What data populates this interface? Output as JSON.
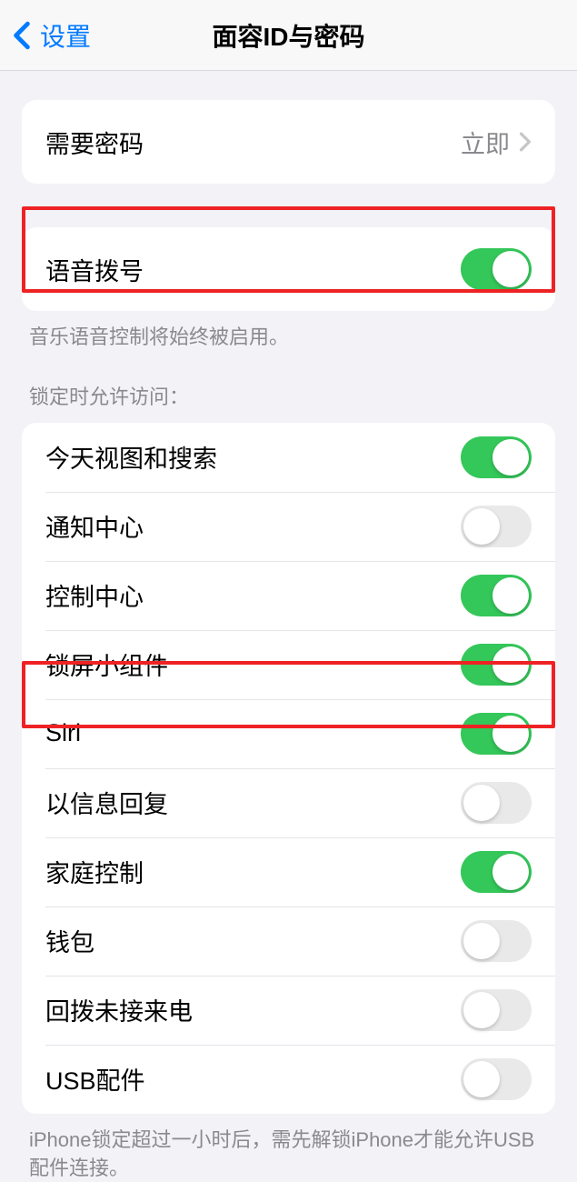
{
  "nav": {
    "back_label": "设置",
    "title": "面容ID与密码"
  },
  "require_passcode": {
    "label": "需要密码",
    "value": "立即"
  },
  "voice_dial": {
    "label": "语音拨号",
    "footer": "音乐语音控制将始终被启用。"
  },
  "lock_access": {
    "header": "锁定时允许访问：",
    "items": [
      {
        "label": "今天视图和搜索",
        "on": true
      },
      {
        "label": "通知中心",
        "on": false
      },
      {
        "label": "控制中心",
        "on": true
      },
      {
        "label": "锁屏小组件",
        "on": true
      },
      {
        "label": "Siri",
        "on": true
      },
      {
        "label": "以信息回复",
        "on": false
      },
      {
        "label": "家庭控制",
        "on": true
      },
      {
        "label": "钱包",
        "on": false
      },
      {
        "label": "回拨未接来电",
        "on": false
      },
      {
        "label": "USB配件",
        "on": false
      }
    ],
    "footer": "iPhone锁定超过一小时后，需先解锁iPhone才能允许USB配件连接。"
  }
}
